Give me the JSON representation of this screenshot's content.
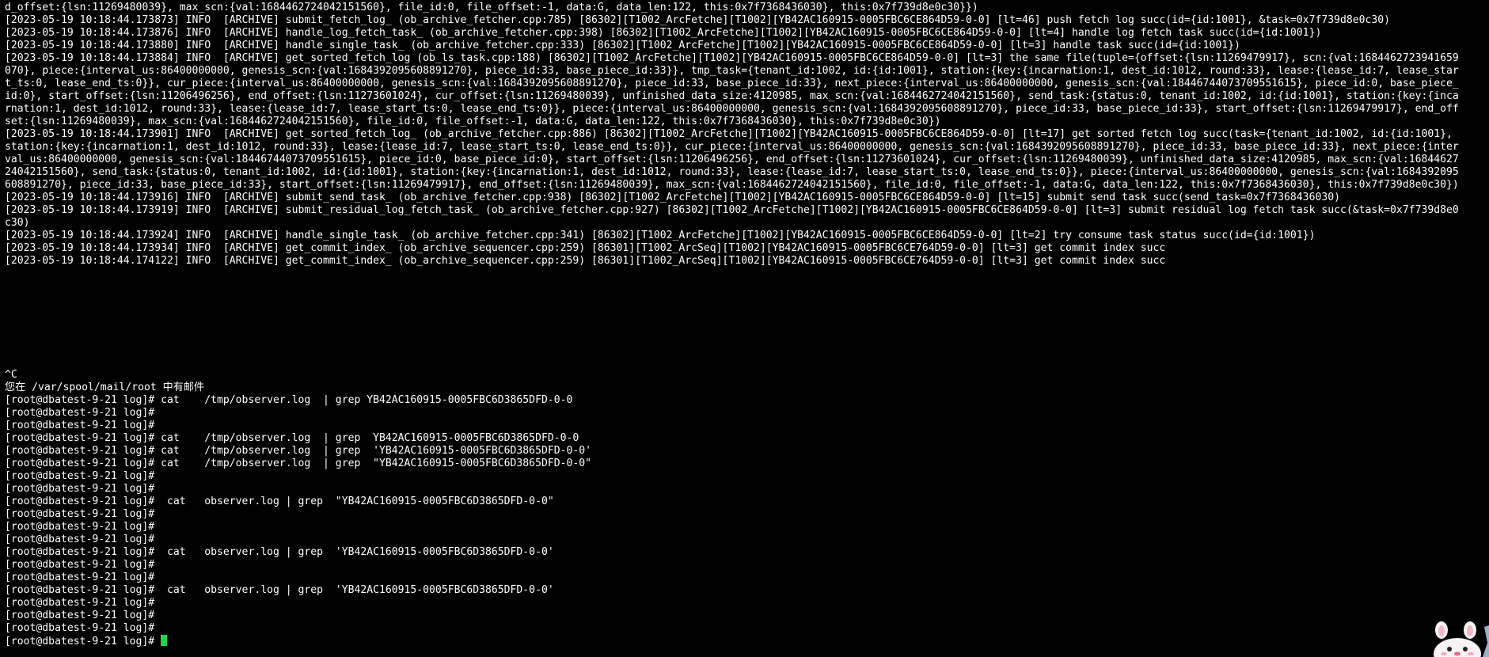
{
  "terminal": {
    "cursor_color": "#22d34a",
    "log_lines": [
      "d_offset:{lsn:11269480039}, max_scn:{val:1684462724042151560}, file_id:0, file_offset:-1, data:G, data_len:122, this:0x7f7368436030}, this:0x7f739d8e0c30}})",
      "[2023-05-19 10:18:44.173873] INFO  [ARCHIVE] submit_fetch_log_ (ob_archive_fetcher.cpp:785) [86302][T1002_ArcFetche][T1002][YB42AC160915-0005FBC6CE864D59-0-0] [lt=46] push fetch log succ(id={id:1001}, &task=0x7f739d8e0c30)",
      "[2023-05-19 10:18:44.173876] INFO  [ARCHIVE] handle_log_fetch_task_ (ob_archive_fetcher.cpp:398) [86302][T1002_ArcFetche][T1002][YB42AC160915-0005FBC6CE864D59-0-0] [lt=4] handle log fetch task succ(id={id:1001})",
      "[2023-05-19 10:18:44.173880] INFO  [ARCHIVE] handle_single_task_ (ob_archive_fetcher.cpp:333) [86302][T1002_ArcFetche][T1002][YB42AC160915-0005FBC6CE864D59-0-0] [lt=3] handle task succ(id={id:1001})",
      "[2023-05-19 10:18:44.173884] INFO  [ARCHIVE] get_sorted_fetch_log (ob_ls_task.cpp:188) [86302][T1002_ArcFetche][T1002][YB42AC160915-0005FBC6CE864D59-0-0] [lt=3] the same file(tuple={offset:{lsn:11269479917}, scn:{val:1684462723941659",
      "070}, piece:{interval_us:86400000000, genesis_scn:{val:1684392095608891270}, piece_id:33, base_piece_id:33}}, tmp_task={tenant_id:1002, id:{id:1001}, station:{key:{incarnation:1, dest_id:1012, round:33}, lease:{lease_id:7, lease_star",
      "t_ts:0, lease_end_ts:0}}, cur_piece:{interval_us:86400000000, genesis_scn:{val:1684392095608891270}, piece_id:33, base_piece_id:33}, next_piece:{interval_us:86400000000, genesis_scn:{val:18446744073709551615}, piece_id:0, base_piece_",
      "id:0}, start_offset:{lsn:11206496256}, end_offset:{lsn:11273601024}, cur_offset:{lsn:11269480039}, unfinished_data_size:4120985, max_scn:{val:1684462724042151560}, send_task:{status:0, tenant_id:1002, id:{id:1001}, station:{key:{inca",
      "rnation:1, dest_id:1012, round:33}, lease:{lease_id:7, lease_start_ts:0, lease_end_ts:0}}, piece:{interval_us:86400000000, genesis_scn:{val:1684392095608891270}, piece_id:33, base_piece_id:33}, start_offset:{lsn:11269479917}, end_off",
      "set:{lsn:11269480039}, max_scn:{val:1684462724042151560}, file_id:0, file_offset:-1, data:G, data_len:122, this:0x7f7368436030}, this:0x7f739d8e0c30})",
      "[2023-05-19 10:18:44.173901] INFO  [ARCHIVE] get_sorted_fetch_log_ (ob_archive_fetcher.cpp:886) [86302][T1002_ArcFetche][T1002][YB42AC160915-0005FBC6CE864D59-0-0] [lt=17] get sorted fetch log succ(task={tenant_id:1002, id:{id:1001},",
      "station:{key:{incarnation:1, dest_id:1012, round:33}, lease:{lease_id:7, lease_start_ts:0, lease_end_ts:0}}, cur_piece:{interval_us:86400000000, genesis_scn:{val:1684392095608891270}, piece_id:33, base_piece_id:33}, next_piece:{inter",
      "val_us:86400000000, genesis_scn:{val:18446744073709551615}, piece_id:0, base_piece_id:0}, start_offset:{lsn:11206496256}, end_offset:{lsn:11273601024}, cur_offset:{lsn:11269480039}, unfinished_data_size:4120985, max_scn:{val:16844627",
      "24042151560}, send_task:{status:0, tenant_id:1002, id:{id:1001}, station:{key:{incarnation:1, dest_id:1012, round:33}, lease:{lease_id:7, lease_start_ts:0, lease_end_ts:0}}, piece:{interval_us:86400000000, genesis_scn:{val:1684392095",
      "608891270}, piece_id:33, base_piece_id:33}, start_offset:{lsn:11269479917}, end_offset:{lsn:11269480039}, max_scn:{val:1684462724042151560}, file_id:0, file_offset:-1, data:G, data_len:122, this:0x7f7368436030}, this:0x7f739d8e0c30})",
      "[2023-05-19 10:18:44.173916] INFO  [ARCHIVE] submit_send_task_ (ob_archive_fetcher.cpp:938) [86302][T1002_ArcFetche][T1002][YB42AC160915-0005FBC6CE864D59-0-0] [lt=15] submit send task succ(send_task=0x7f7368436030)",
      "[2023-05-19 10:18:44.173919] INFO  [ARCHIVE] submit_residual_log_fetch_task_ (ob_archive_fetcher.cpp:927) [86302][T1002_ArcFetche][T1002][YB42AC160915-0005FBC6CE864D59-0-0] [lt=3] submit residual log fetch task succ(&task=0x7f739d8e0",
      "c30)",
      "[2023-05-19 10:18:44.173924] INFO  [ARCHIVE] handle_single_task_ (ob_archive_fetcher.cpp:341) [86302][T1002_ArcFetche][T1002][YB42AC160915-0005FBC6CE864D59-0-0] [lt=2] try consume task status succ(id={id:1001})",
      "[2023-05-19 10:18:44.173934] INFO  [ARCHIVE] get_commit_index_ (ob_archive_sequencer.cpp:259) [86301][T1002_ArcSeq][T1002][YB42AC160915-0005FBC6CE764D59-0-0] [lt=3] get commit index succ",
      "[2023-05-19 10:18:44.174122] INFO  [ARCHIVE] get_commit_index_ (ob_archive_sequencer.cpp:259) [86301][T1002_ArcSeq][T1002][YB42AC160915-0005FBC6CE764D59-0-0] [lt=3] get commit index succ"
    ],
    "shell_lines": [
      "^C",
      "您在 /var/spool/mail/root 中有邮件",
      "[root@dbatest-9-21 log]# cat    /tmp/observer.log  | grep YB42AC160915-0005FBC6D3865DFD-0-0",
      "[root@dbatest-9-21 log]#",
      "[root@dbatest-9-21 log]#",
      "[root@dbatest-9-21 log]# cat    /tmp/observer.log  | grep  YB42AC160915-0005FBC6D3865DFD-0-0",
      "[root@dbatest-9-21 log]# cat    /tmp/observer.log  | grep  'YB42AC160915-0005FBC6D3865DFD-0-0'",
      "[root@dbatest-9-21 log]# cat    /tmp/observer.log  | grep  \"YB42AC160915-0005FBC6D3865DFD-0-0\"",
      "[root@dbatest-9-21 log]#",
      "[root@dbatest-9-21 log]#",
      "[root@dbatest-9-21 log]#  cat   observer.log | grep  \"YB42AC160915-0005FBC6D3865DFD-0-0\"",
      "[root@dbatest-9-21 log]#",
      "[root@dbatest-9-21 log]#",
      "[root@dbatest-9-21 log]#",
      "[root@dbatest-9-21 log]#  cat   observer.log | grep  'YB42AC160915-0005FBC6D3865DFD-0-0'",
      "[root@dbatest-9-21 log]#",
      "[root@dbatest-9-21 log]#",
      "[root@dbatest-9-21 log]#  cat   observer.log | grep  'YB42AC160915-0005FBC6D3865DFD-0-0'",
      "[root@dbatest-9-21 log]#",
      "[root@dbatest-9-21 log]#",
      "[root@dbatest-9-21 log]#"
    ],
    "active_prompt": "[root@dbatest-9-21 log]# "
  }
}
